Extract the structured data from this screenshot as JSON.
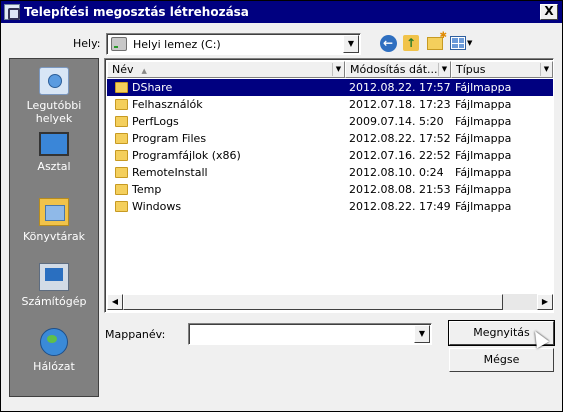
{
  "window": {
    "title": "Telepítési megosztás létrehozása",
    "close_label": "X"
  },
  "lookin": {
    "label": "Hely:",
    "value": "Helyi lemez (C:)"
  },
  "places": [
    {
      "label": "Legutóbbi helyek",
      "icon": "recent-places-icon"
    },
    {
      "label": "Asztal",
      "icon": "desktop-icon"
    },
    {
      "label": "Könyvtárak",
      "icon": "libraries-icon"
    },
    {
      "label": "Számítógép",
      "icon": "computer-icon"
    },
    {
      "label": "Hálózat",
      "icon": "network-icon"
    }
  ],
  "columns": {
    "name": "Név",
    "date": "Módosítás dát...",
    "type": "Típus"
  },
  "files": [
    {
      "name": "DShare",
      "date": "2012.08.22. 17:57",
      "type": "Fájlmappa",
      "selected": true
    },
    {
      "name": "Felhasználók",
      "date": "2012.07.18. 17:23",
      "type": "Fájlmappa"
    },
    {
      "name": "PerfLogs",
      "date": "2009.07.14. 5:20",
      "type": "Fájlmappa"
    },
    {
      "name": "Program Files",
      "date": "2012.08.22. 17:52",
      "type": "Fájlmappa"
    },
    {
      "name": "Programfájlok (x86)",
      "date": "2012.07.16. 22:52",
      "type": "Fájlmappa"
    },
    {
      "name": "RemoteInstall",
      "date": "2012.08.10. 0:24",
      "type": "Fájlmappa"
    },
    {
      "name": "Temp",
      "date": "2012.08.08. 21:53",
      "type": "Fájlmappa"
    },
    {
      "name": "Windows",
      "date": "2012.08.22. 17:49",
      "type": "Fájlmappa"
    }
  ],
  "folder_name": {
    "label": "Mappanév:",
    "value": ""
  },
  "buttons": {
    "open": "Megnyitás",
    "cancel": "Mégse"
  },
  "colors": {
    "titlebar": "#000080",
    "selection": "#000080",
    "places_bg": "#808080"
  }
}
